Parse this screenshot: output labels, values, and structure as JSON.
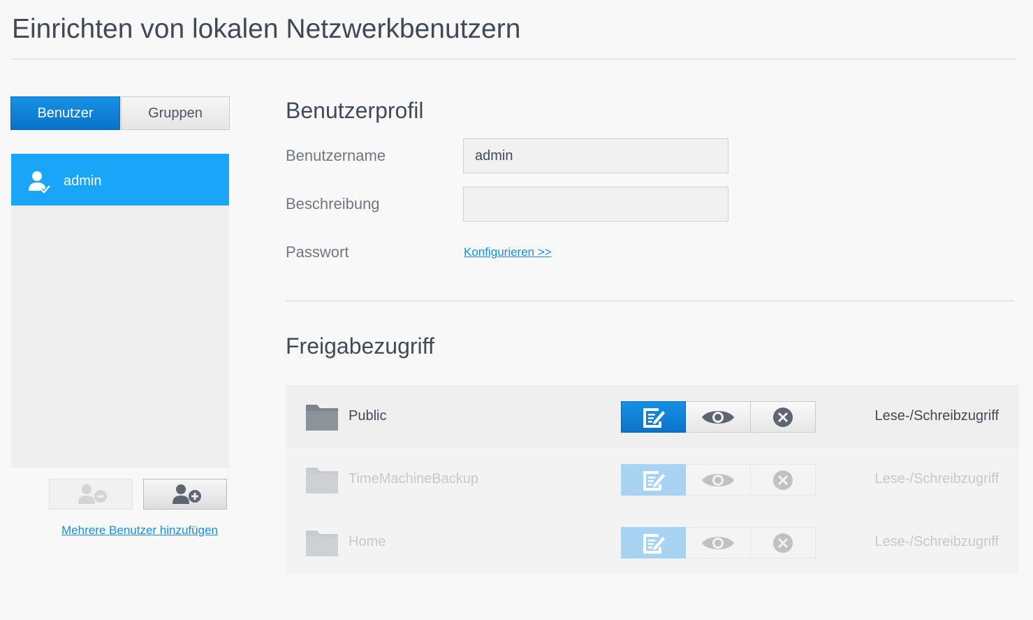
{
  "page": {
    "title": "Einrichten von lokalen Netzwerkbenutzern"
  },
  "tabs": {
    "users": "Benutzer",
    "groups": "Gruppen"
  },
  "user_list": {
    "items": [
      {
        "name": "admin",
        "selected": true
      }
    ]
  },
  "user_actions": {
    "add_multiple": "Mehrere Benutzer hinzufügen"
  },
  "profile": {
    "title": "Benutzerprofil",
    "username_label": "Benutzername",
    "username_value": "admin",
    "description_label": "Beschreibung",
    "description_value": "",
    "password_label": "Passwort",
    "password_link": "Konfigurieren >>"
  },
  "shares": {
    "title": "Freigabezugriff",
    "rows": [
      {
        "name": "Public",
        "access": "Lese-/Schreibzugriff",
        "selected": "read-write",
        "enabled": true
      },
      {
        "name": "TimeMachineBackup",
        "access": "Lese-/Schreibzugriff",
        "selected": "read-write",
        "enabled": false
      },
      {
        "name": "Home",
        "access": "Lese-/Schreibzugriff",
        "selected": "read-write",
        "enabled": false
      }
    ]
  },
  "colors": {
    "accent": "#0a7fd6",
    "selected_item": "#1aa6f8",
    "link": "#1a8ee0"
  }
}
